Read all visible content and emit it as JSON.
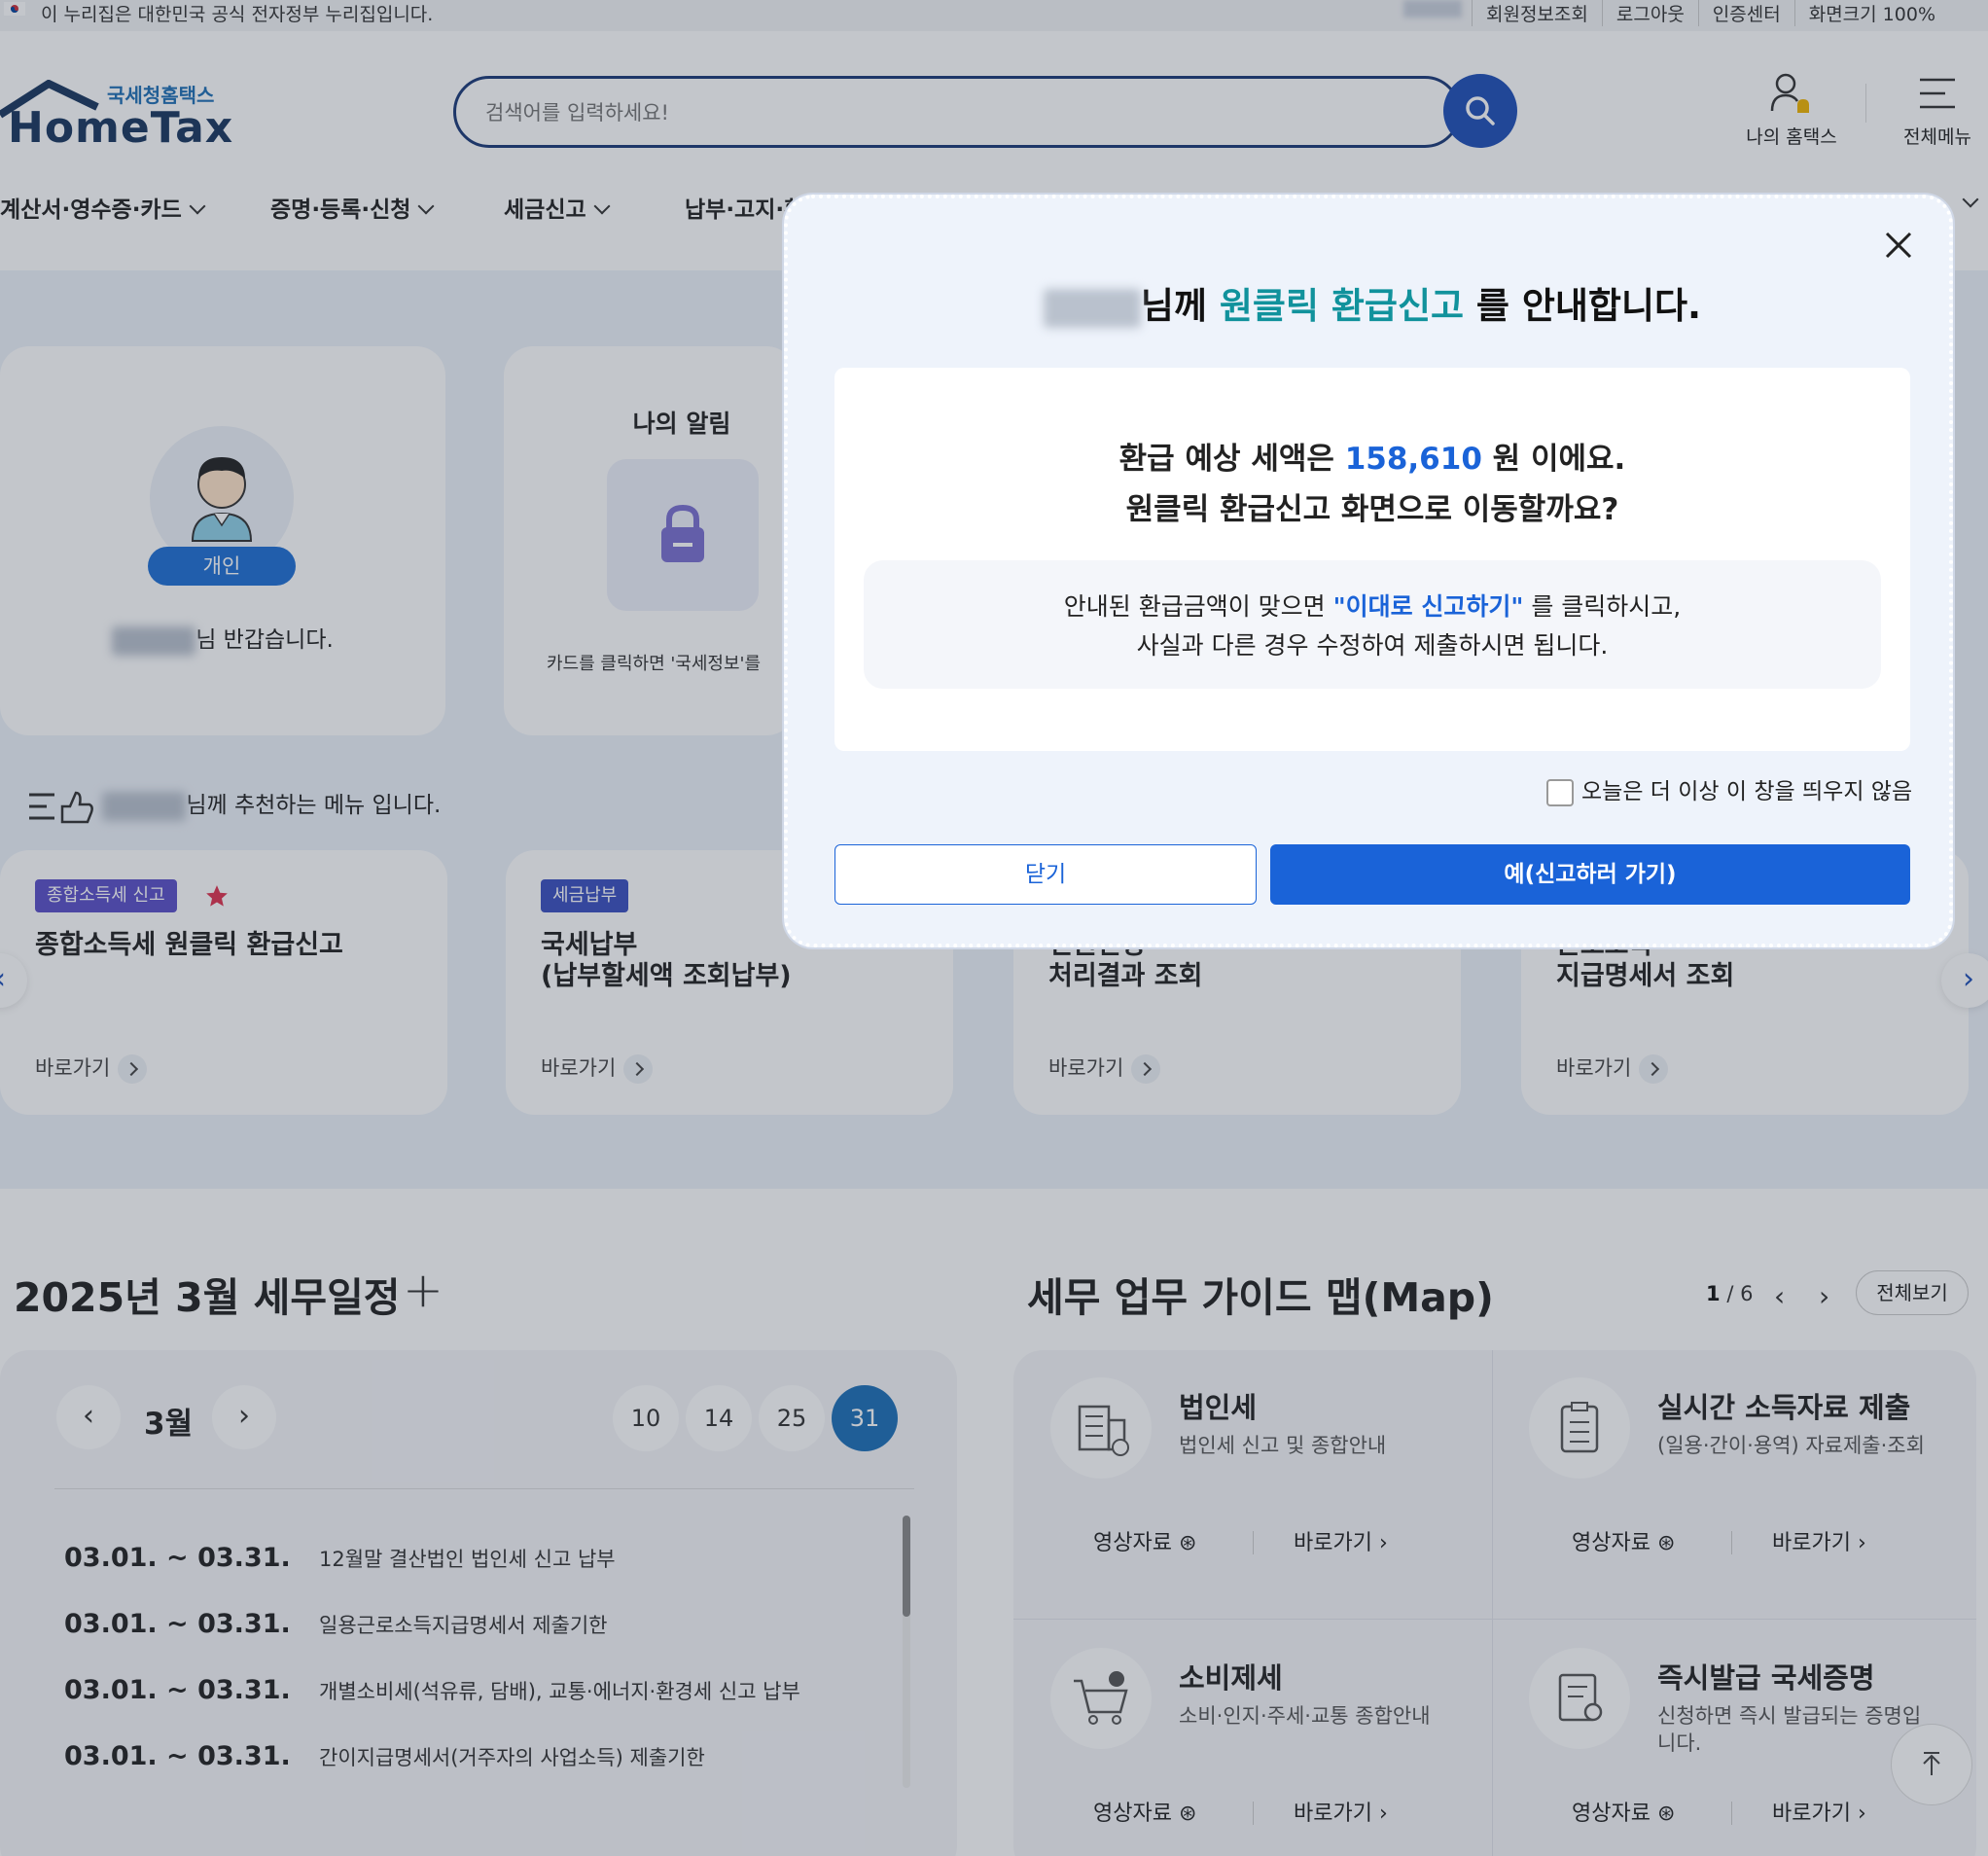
{
  "gov_strip": {
    "text": "이 누리집은 대한민국 공식 전자정부 누리집입니다.",
    "links": [
      "회원정보조회",
      "로그아웃",
      "인증센터",
      "화면크기 100%"
    ]
  },
  "header": {
    "logo_sub": "국세청홈택스",
    "logo_main": "HomeTax",
    "search_placeholder": "검색어를 입력하세요!",
    "my_hometax": "나의 홈택스",
    "all_menu": "전체메뉴"
  },
  "gnb": [
    "계산서·영수증·카드",
    "증명·등록·신청",
    "세금신고",
    "납부·고지·환"
  ],
  "profile": {
    "badge": "개인",
    "greet_suffix": "님 반갑습니다."
  },
  "alert": {
    "title": "나의 알림",
    "hint": "카드를 클릭하면 '국세정보'를"
  },
  "reco": {
    "title_suffix": "님께 추천하는 메뉴 입니다.",
    "cards": [
      {
        "tag": "종합소득세 신고",
        "tag_color": "#5a4fc8",
        "name": "종합소득세 원클릭 환급신고",
        "go": "바로가기"
      },
      {
        "tag": "세금납부",
        "tag_color": "#3b4fc0",
        "name": "국세납부\n(납부할세액 조회납부)",
        "go": "바로가기"
      },
      {
        "name": "민원신청\n처리결과 조회",
        "go": "바로가기"
      },
      {
        "name": "근로소득\n지급명세서 조회",
        "go": "바로가기"
      }
    ]
  },
  "schedule": {
    "title": "2025년 3월 세무일정",
    "month": "3월",
    "days": [
      "10",
      "14",
      "25",
      "31"
    ],
    "active_day": "31",
    "rows": [
      {
        "date": "03.01. ~ 03.31.",
        "desc": "12월말 결산법인 법인세 신고 납부"
      },
      {
        "date": "03.01. ~ 03.31.",
        "desc": "일용근로소득지급명세서 제출기한"
      },
      {
        "date": "03.01. ~ 03.31.",
        "desc": "개별소비세(석유류, 담배), 교통·에너지·환경세 신고 납부"
      },
      {
        "date": "03.01. ~ 03.31.",
        "desc": "간이지급명세서(거주자의 사업소득) 제출기한"
      }
    ]
  },
  "guide": {
    "title": "세무 업무 가이드 맵(Map)",
    "page_current": "1",
    "page_total": "/ 6",
    "view_all": "전체보기",
    "items": [
      {
        "title": "법인세",
        "sub": "법인세 신고 및 종합안내",
        "video": "영상자료",
        "go": "바로가기"
      },
      {
        "title": "실시간 소득자료 제출",
        "sub": "(일용·간이·용역) 자료제출·조회",
        "video": "영상자료",
        "go": "바로가기"
      },
      {
        "title": "소비제세",
        "sub": "소비·인지·주세·교통 종합안내",
        "video": "영상자료",
        "go": "바로가기"
      },
      {
        "title": "즉시발급 국세증명",
        "sub": "신청하면 즉시 발급되는 증명입\n니다.",
        "video": "영상자료",
        "go": "바로가기"
      }
    ]
  },
  "modal": {
    "title_mid": "님께 ",
    "title_hl": "원클릭 환급신고",
    "title_end": " 를 안내합니다.",
    "q1_pre": "환급 예상 세액은 ",
    "q1_amount": "158,610",
    "q1_post": " 원 이에요.",
    "q2": "원클릭 환급신고 화면으로 이동할까요?",
    "n1_pre": "안내된 환급금액이 맞으면 ",
    "n1_hl": "\"이대로 신고하기\"",
    "n1_post": " 를 클릭하시고,",
    "n2": "사실과 다른 경우 수정하여 제출하시면 됩니다.",
    "checkbox": "오늘은 더 이상 이 창을 띄우지 않음",
    "btn_close": "닫기",
    "btn_yes": "예(신고하러 가기)"
  }
}
